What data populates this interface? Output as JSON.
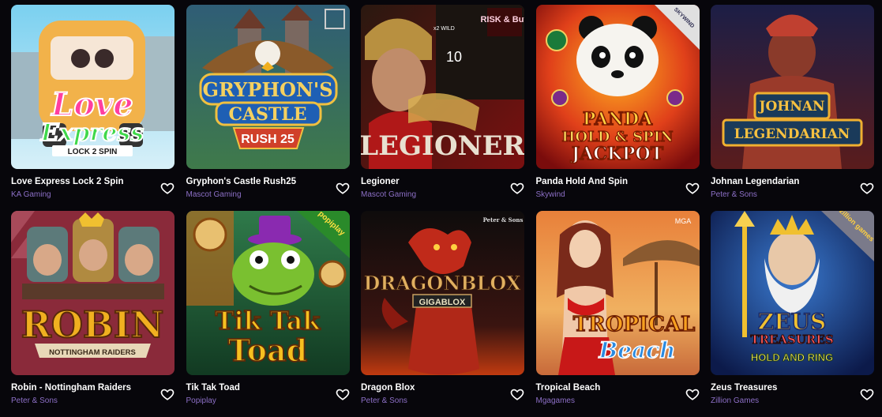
{
  "games": [
    {
      "title": "Love Express Lock 2 Spin",
      "provider": "KA Gaming",
      "art": {
        "line1": "Love",
        "line2": "Express",
        "sub": "LOCK 2 SPIN"
      }
    },
    {
      "title": "Gryphon's Castle Rush25",
      "provider": "Mascot Gaming",
      "art": {
        "line1": "GRYPHON'S",
        "line2": "CASTLE",
        "sub": "RUSH 25"
      }
    },
    {
      "title": "Legioner",
      "provider": "Mascot Gaming",
      "art": {
        "line1": "LEGIONER",
        "badge": "RISK & Buy",
        "num": "10",
        "side": "x2 WILD"
      }
    },
    {
      "title": "Panda Hold And Spin",
      "provider": "Skywind",
      "art": {
        "line1": "PANDA",
        "line2": "HOLD & SPIN",
        "line3": "JACKPOT",
        "badge": "SKYWIND"
      }
    },
    {
      "title": "Johnan Legendarian",
      "provider": "Peter & Sons",
      "art": {
        "line1": "JOHNAN",
        "line2": "LEGENDARIAN"
      }
    },
    {
      "title": "Robin - Nottingham Raiders",
      "provider": "Peter & Sons",
      "art": {
        "line1": "ROBIN",
        "sub": "NOTTINGHAM RAIDERS"
      }
    },
    {
      "title": "Tik Tak Toad",
      "provider": "Popiplay",
      "art": {
        "line1": "Tik Tak",
        "line2": "Toad",
        "badge": "popiplay"
      }
    },
    {
      "title": "Dragon Blox",
      "provider": "Peter & Sons",
      "art": {
        "line1": "DRAGONBLOX",
        "sub": "GIGABLOX",
        "badge": "Peter & Sons"
      }
    },
    {
      "title": "Tropical Beach",
      "provider": "Mgagames",
      "art": {
        "line1": "TROPICAL",
        "line2": "Beach",
        "badge": "MGA"
      }
    },
    {
      "title": "Zeus Treasures",
      "provider": "Zillion Games",
      "art": {
        "line1": "ZEUS",
        "line2": "TREASURES",
        "sub": "HOLD AND RING",
        "badge": "zillion games"
      }
    }
  ]
}
